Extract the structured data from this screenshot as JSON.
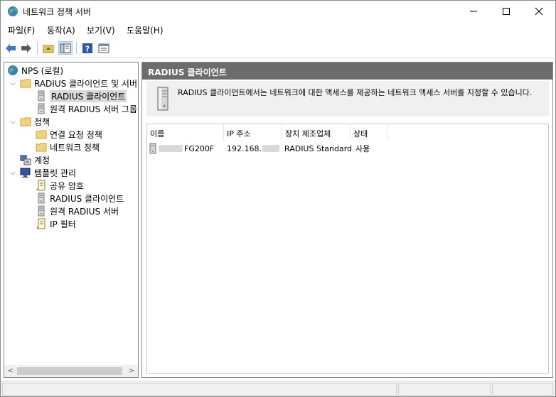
{
  "window": {
    "title": "네트워크 정책 서버"
  },
  "menu": {
    "items": [
      "파일(F)",
      "동작(A)",
      "보기(V)",
      "도움말(H)"
    ]
  },
  "toolbar": {
    "buttons": [
      "back-arrow-icon",
      "forward-arrow-icon",
      "up-folder-icon",
      "show-hide-tree-icon",
      "help-icon",
      "properties-icon"
    ]
  },
  "tree": {
    "items": [
      {
        "label": "NPS (로컬)",
        "icon": "nps-globe-icon"
      },
      {
        "label": "RADIUS 클라이언트 및 서버",
        "icon": "folder-icon"
      },
      {
        "label": "RADIUS 클라이언트",
        "icon": "server-icon"
      },
      {
        "label": "원격 RADIUS 서버 그룹",
        "icon": "server-icon"
      },
      {
        "label": "정책",
        "icon": "folder-icon"
      },
      {
        "label": "연결 요청 정책",
        "icon": "folder-icon"
      },
      {
        "label": "네트워크 정책",
        "icon": "folder-icon"
      },
      {
        "label": "계정",
        "icon": "accounting-icon"
      },
      {
        "label": "템플릿 관리",
        "icon": "template-monitor-icon"
      },
      {
        "label": "공유 암호",
        "icon": "scroll-icon"
      },
      {
        "label": "RADIUS 클라이언트",
        "icon": "server-icon"
      },
      {
        "label": "원격 RADIUS 서버",
        "icon": "server-icon"
      },
      {
        "label": "IP 필터",
        "icon": "scroll-icon"
      }
    ]
  },
  "right": {
    "header": "RADIUS 클라이언트",
    "description": "RADIUS 클라이언트에서는 네트워크에 대한 액세스를 제공하는 네트워크 액세스 서버를 지정할 수 있습니다.",
    "columns": [
      "이름",
      "IP 주소",
      "장치 제조업체",
      "상태"
    ],
    "rows": [
      {
        "name": "FG200F",
        "ip": "192.168.",
        "vendor": "RADIUS Standard",
        "status": "사용"
      }
    ]
  }
}
